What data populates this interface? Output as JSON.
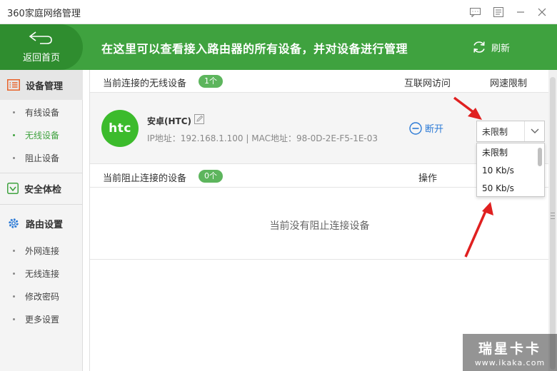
{
  "window": {
    "title": "360家庭网络管理"
  },
  "header": {
    "home_label": "返回首页",
    "message": "在这里可以查看接入路由器的所有设备，并对设备进行管理",
    "refresh_label": "刷新"
  },
  "sidebar": {
    "sections": [
      {
        "label": "设备管理",
        "icon": "list-icon",
        "items": [
          "有线设备",
          "无线设备",
          "阻止设备"
        ]
      },
      {
        "label": "安全体检",
        "icon": "shield-icon",
        "items": []
      },
      {
        "label": "路由设置",
        "icon": "gear-icon",
        "items": [
          "外网连接",
          "无线连接",
          "修改密码",
          "更多设置"
        ]
      }
    ],
    "active_item": "无线设备"
  },
  "wireless": {
    "title": "当前连接的无线设备",
    "count": "1个",
    "col_internet": "互联网访问",
    "col_speed": "网速限制",
    "device": {
      "avatar_text": "htc",
      "name": "安卓(HTC)",
      "info": "IP地址：192.168.1.100 | MAC地址：98-0D-2E-F5-1E-03",
      "disconnect_label": "断开",
      "speed_limit": "未限制"
    }
  },
  "blocked": {
    "title": "当前阻止连接的设备",
    "count": "0个",
    "col_action": "操作",
    "empty_text": "当前没有阻止连接设备"
  },
  "dropdown": {
    "options": [
      "未限制",
      "10 Kb/s",
      "50 Kb/s"
    ]
  },
  "watermark": {
    "brand": "瑞星卡卡",
    "url": "www.ikaka.com"
  },
  "colors": {
    "brand_green": "#3fa23f",
    "link_blue": "#2d7bd6",
    "annotation_red": "#e02020"
  }
}
